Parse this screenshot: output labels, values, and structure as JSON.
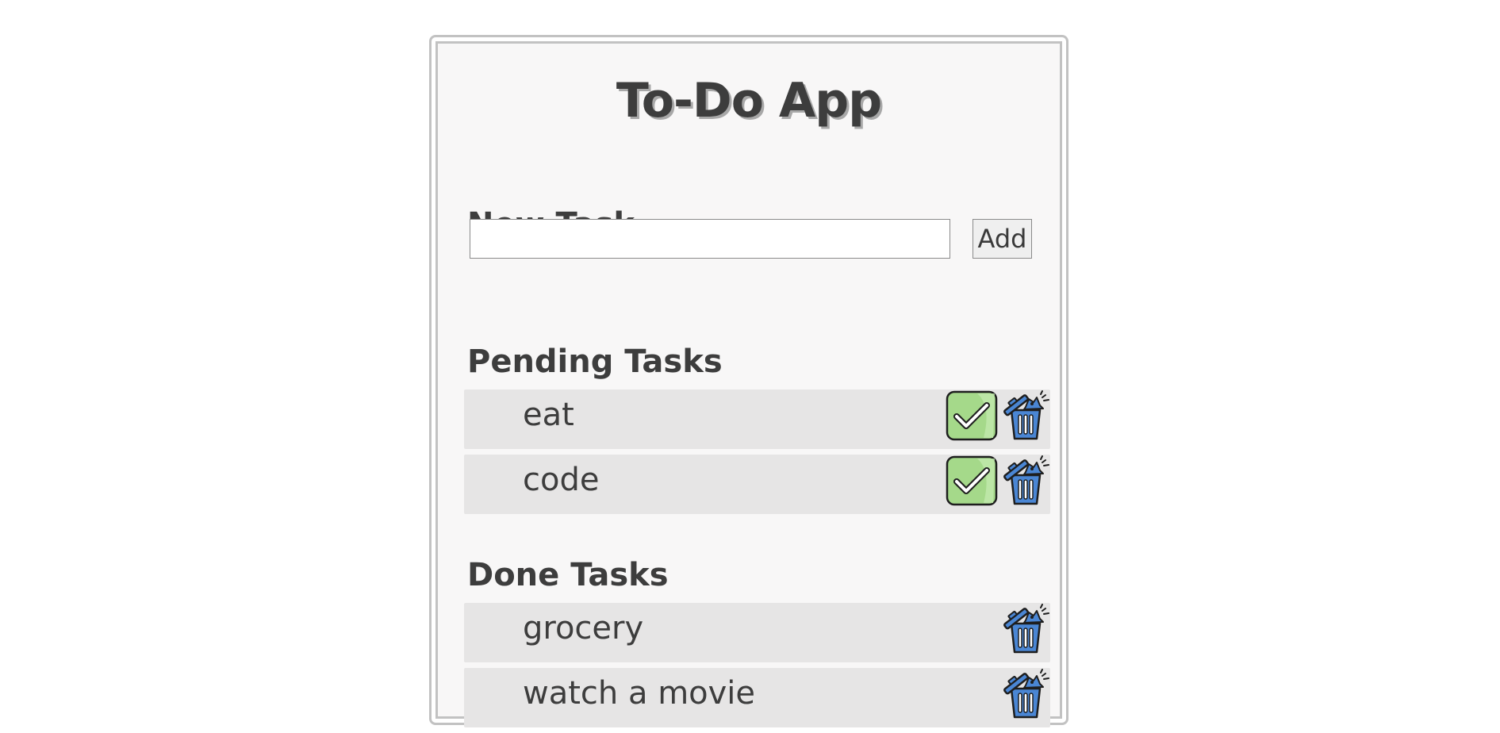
{
  "app": {
    "title": "To-Do App"
  },
  "new_task": {
    "heading": "New Task",
    "input_value": "",
    "input_placeholder": "",
    "add_label": "Add"
  },
  "pending": {
    "heading": "Pending Tasks",
    "items": [
      {
        "label": "eat"
      },
      {
        "label": "code"
      }
    ]
  },
  "done": {
    "heading": "Done Tasks",
    "items": [
      {
        "label": "grocery"
      },
      {
        "label": "watch a movie"
      }
    ]
  },
  "icons": {
    "complete": "check-icon",
    "delete": "trash-icon"
  },
  "colors": {
    "check_fill": "#a5d98a",
    "trash_fill": "#4a86d4",
    "row_bg": "#e6e5e5",
    "panel_bg": "#f8f7f7"
  }
}
